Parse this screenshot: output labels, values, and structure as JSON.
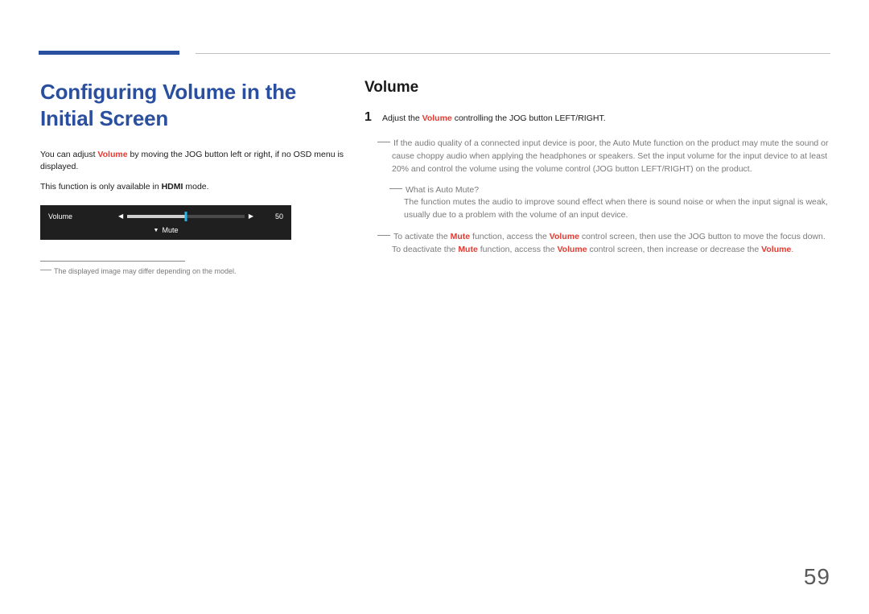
{
  "page_number": "59",
  "left": {
    "title": "Configuring Volume in the Initial Screen",
    "p1_a": "You can adjust ",
    "p1_vol": "Volume",
    "p1_b": " by moving the JOG button left or right, if no OSD menu is displayed.",
    "p2_a": "This function is only available in ",
    "p2_hdmi": "HDMI",
    "p2_b": " mode.",
    "osd": {
      "label": "Volume",
      "value": "50",
      "mute": "Mute"
    },
    "footnote": "The displayed image may differ depending on the model."
  },
  "right": {
    "title": "Volume",
    "step1_num": "1",
    "step1_a": "Adjust the ",
    "step1_vol": "Volume",
    "step1_b": " controlling the JOG button LEFT/RIGHT.",
    "note1": "If the audio quality of a connected input device is poor, the Auto Mute function on the product may mute the sound or cause choppy audio when applying the headphones or speakers. Set the input volume for the input device to at least 20% and control the volume using the volume control (JOG button LEFT/RIGHT) on the product.",
    "inner_q": "What is Auto Mute?",
    "inner_a": "The function mutes the audio to improve sound effect when there is sound noise or when the input signal is weak, usually due to a problem with the volume of an input device.",
    "note2_a": "To activate the ",
    "note2_mute1": "Mute",
    "note2_b": " function, access the ",
    "note2_vol1": "Volume",
    "note2_c": " control screen, then use the JOG button to move the focus down.",
    "note2_d": "To deactivate the ",
    "note2_mute2": "Mute",
    "note2_e": " function, access the ",
    "note2_vol2": "Volume",
    "note2_f": " control screen, then increase or decrease the ",
    "note2_vol3": "Volume",
    "note2_g": "."
  }
}
